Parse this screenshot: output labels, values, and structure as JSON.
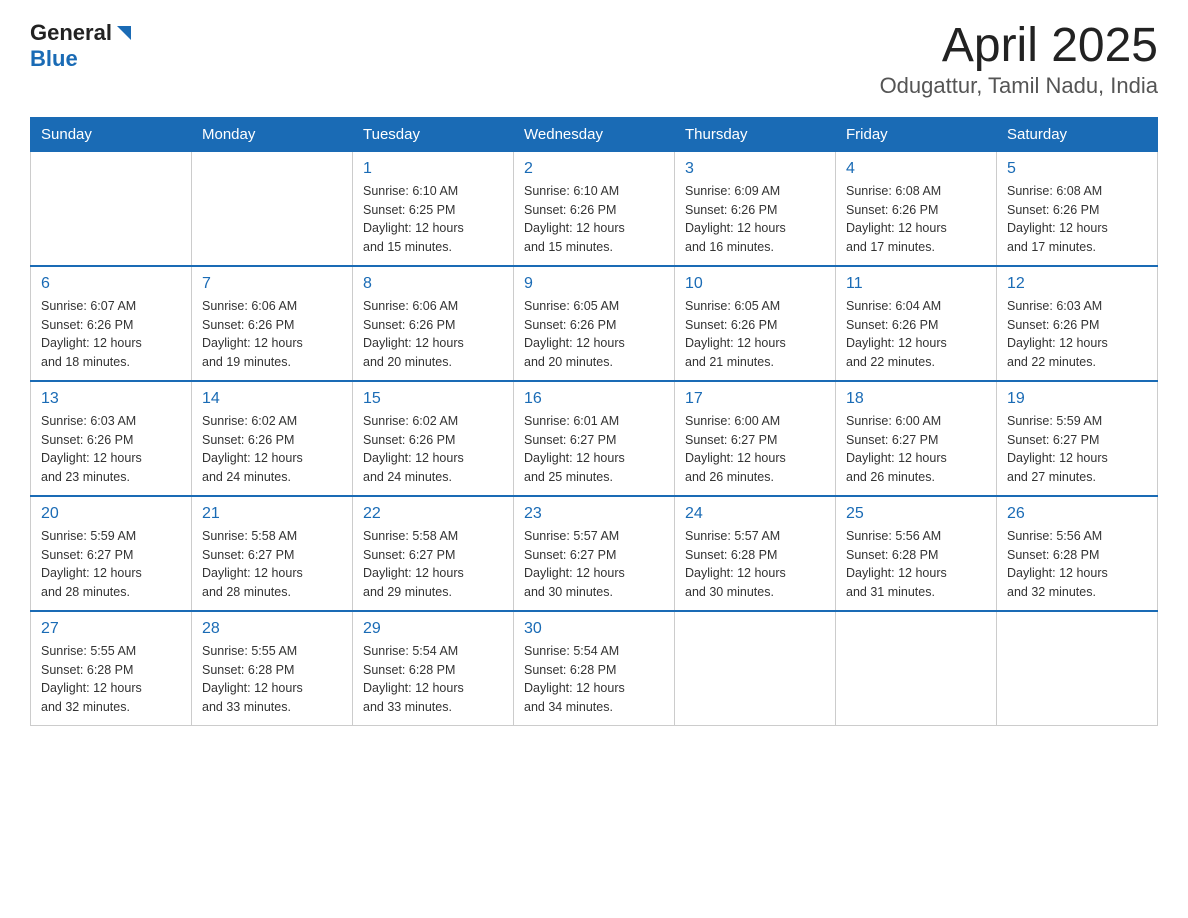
{
  "header": {
    "logo_general": "General",
    "logo_blue": "Blue",
    "title": "April 2025",
    "subtitle": "Odugattur, Tamil Nadu, India"
  },
  "days_of_week": [
    "Sunday",
    "Monday",
    "Tuesday",
    "Wednesday",
    "Thursday",
    "Friday",
    "Saturday"
  ],
  "weeks": [
    [
      {
        "day": "",
        "info": ""
      },
      {
        "day": "",
        "info": ""
      },
      {
        "day": "1",
        "info": "Sunrise: 6:10 AM\nSunset: 6:25 PM\nDaylight: 12 hours\nand 15 minutes."
      },
      {
        "day": "2",
        "info": "Sunrise: 6:10 AM\nSunset: 6:26 PM\nDaylight: 12 hours\nand 15 minutes."
      },
      {
        "day": "3",
        "info": "Sunrise: 6:09 AM\nSunset: 6:26 PM\nDaylight: 12 hours\nand 16 minutes."
      },
      {
        "day": "4",
        "info": "Sunrise: 6:08 AM\nSunset: 6:26 PM\nDaylight: 12 hours\nand 17 minutes."
      },
      {
        "day": "5",
        "info": "Sunrise: 6:08 AM\nSunset: 6:26 PM\nDaylight: 12 hours\nand 17 minutes."
      }
    ],
    [
      {
        "day": "6",
        "info": "Sunrise: 6:07 AM\nSunset: 6:26 PM\nDaylight: 12 hours\nand 18 minutes."
      },
      {
        "day": "7",
        "info": "Sunrise: 6:06 AM\nSunset: 6:26 PM\nDaylight: 12 hours\nand 19 minutes."
      },
      {
        "day": "8",
        "info": "Sunrise: 6:06 AM\nSunset: 6:26 PM\nDaylight: 12 hours\nand 20 minutes."
      },
      {
        "day": "9",
        "info": "Sunrise: 6:05 AM\nSunset: 6:26 PM\nDaylight: 12 hours\nand 20 minutes."
      },
      {
        "day": "10",
        "info": "Sunrise: 6:05 AM\nSunset: 6:26 PM\nDaylight: 12 hours\nand 21 minutes."
      },
      {
        "day": "11",
        "info": "Sunrise: 6:04 AM\nSunset: 6:26 PM\nDaylight: 12 hours\nand 22 minutes."
      },
      {
        "day": "12",
        "info": "Sunrise: 6:03 AM\nSunset: 6:26 PM\nDaylight: 12 hours\nand 22 minutes."
      }
    ],
    [
      {
        "day": "13",
        "info": "Sunrise: 6:03 AM\nSunset: 6:26 PM\nDaylight: 12 hours\nand 23 minutes."
      },
      {
        "day": "14",
        "info": "Sunrise: 6:02 AM\nSunset: 6:26 PM\nDaylight: 12 hours\nand 24 minutes."
      },
      {
        "day": "15",
        "info": "Sunrise: 6:02 AM\nSunset: 6:26 PM\nDaylight: 12 hours\nand 24 minutes."
      },
      {
        "day": "16",
        "info": "Sunrise: 6:01 AM\nSunset: 6:27 PM\nDaylight: 12 hours\nand 25 minutes."
      },
      {
        "day": "17",
        "info": "Sunrise: 6:00 AM\nSunset: 6:27 PM\nDaylight: 12 hours\nand 26 minutes."
      },
      {
        "day": "18",
        "info": "Sunrise: 6:00 AM\nSunset: 6:27 PM\nDaylight: 12 hours\nand 26 minutes."
      },
      {
        "day": "19",
        "info": "Sunrise: 5:59 AM\nSunset: 6:27 PM\nDaylight: 12 hours\nand 27 minutes."
      }
    ],
    [
      {
        "day": "20",
        "info": "Sunrise: 5:59 AM\nSunset: 6:27 PM\nDaylight: 12 hours\nand 28 minutes."
      },
      {
        "day": "21",
        "info": "Sunrise: 5:58 AM\nSunset: 6:27 PM\nDaylight: 12 hours\nand 28 minutes."
      },
      {
        "day": "22",
        "info": "Sunrise: 5:58 AM\nSunset: 6:27 PM\nDaylight: 12 hours\nand 29 minutes."
      },
      {
        "day": "23",
        "info": "Sunrise: 5:57 AM\nSunset: 6:27 PM\nDaylight: 12 hours\nand 30 minutes."
      },
      {
        "day": "24",
        "info": "Sunrise: 5:57 AM\nSunset: 6:28 PM\nDaylight: 12 hours\nand 30 minutes."
      },
      {
        "day": "25",
        "info": "Sunrise: 5:56 AM\nSunset: 6:28 PM\nDaylight: 12 hours\nand 31 minutes."
      },
      {
        "day": "26",
        "info": "Sunrise: 5:56 AM\nSunset: 6:28 PM\nDaylight: 12 hours\nand 32 minutes."
      }
    ],
    [
      {
        "day": "27",
        "info": "Sunrise: 5:55 AM\nSunset: 6:28 PM\nDaylight: 12 hours\nand 32 minutes."
      },
      {
        "day": "28",
        "info": "Sunrise: 5:55 AM\nSunset: 6:28 PM\nDaylight: 12 hours\nand 33 minutes."
      },
      {
        "day": "29",
        "info": "Sunrise: 5:54 AM\nSunset: 6:28 PM\nDaylight: 12 hours\nand 33 minutes."
      },
      {
        "day": "30",
        "info": "Sunrise: 5:54 AM\nSunset: 6:28 PM\nDaylight: 12 hours\nand 34 minutes."
      },
      {
        "day": "",
        "info": ""
      },
      {
        "day": "",
        "info": ""
      },
      {
        "day": "",
        "info": ""
      }
    ]
  ]
}
